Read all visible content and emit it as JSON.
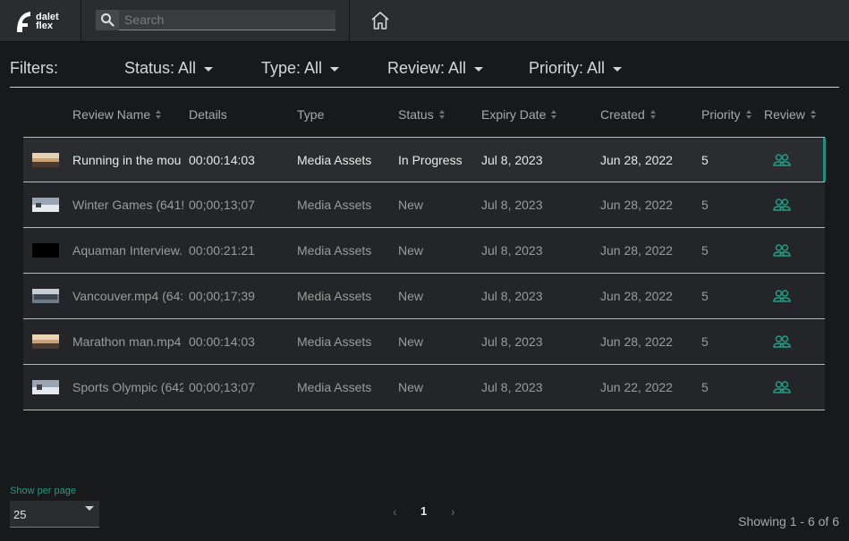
{
  "brand": {
    "logo_text": "dalet\nflex"
  },
  "search": {
    "placeholder": "Search"
  },
  "filters": {
    "label": "Filters:",
    "status": "Status: All",
    "type": "Type: All",
    "review": "Review: All",
    "priority": "Priority: All"
  },
  "table": {
    "columns": {
      "review_name": "Review Name",
      "details": "Details",
      "type": "Type",
      "status": "Status",
      "expiry_date": "Expiry Date",
      "created": "Created",
      "priority": "Priority",
      "review": "Review"
    },
    "rows": [
      {
        "name": "Running in the mou",
        "details": "00:00:14:03",
        "type": "Media Assets",
        "status": "In Progress",
        "expiry": "Jul 8, 2023",
        "created": "Jun 28, 2022",
        "priority": "5"
      },
      {
        "name": "Winter Games (641!",
        "details": "00;00;13;07",
        "type": "Media Assets",
        "status": "New",
        "expiry": "Jul 8, 2023",
        "created": "Jun 28, 2022",
        "priority": "5"
      },
      {
        "name": "Aquaman Interview.",
        "details": "00:00:21:21",
        "type": "Media Assets",
        "status": "New",
        "expiry": "Jul 8, 2023",
        "created": "Jun 28, 2022",
        "priority": "5"
      },
      {
        "name": "Vancouver.mp4 (64:",
        "details": "00;00;17;39",
        "type": "Media Assets",
        "status": "New",
        "expiry": "Jul 8, 2023",
        "created": "Jun 28, 2022",
        "priority": "5"
      },
      {
        "name": "Marathon man.mp4",
        "details": "00:00:14:03",
        "type": "Media Assets",
        "status": "New",
        "expiry": "Jul 8, 2023",
        "created": "Jun 28, 2022",
        "priority": "5"
      },
      {
        "name": "Sports Olympic (642",
        "details": "00;00;13;07",
        "type": "Media Assets",
        "status": "New",
        "expiry": "Jul 8, 2023",
        "created": "Jun 22, 2022",
        "priority": "5"
      }
    ]
  },
  "footer": {
    "per_page_label": "Show per page",
    "per_page_value": "25",
    "prev": "‹",
    "current_page": "1",
    "next": "›",
    "showing": "Showing 1 - 6 of 6"
  },
  "colors": {
    "accent": "#1f9d86",
    "selected_bar": "#1f8f7c"
  }
}
